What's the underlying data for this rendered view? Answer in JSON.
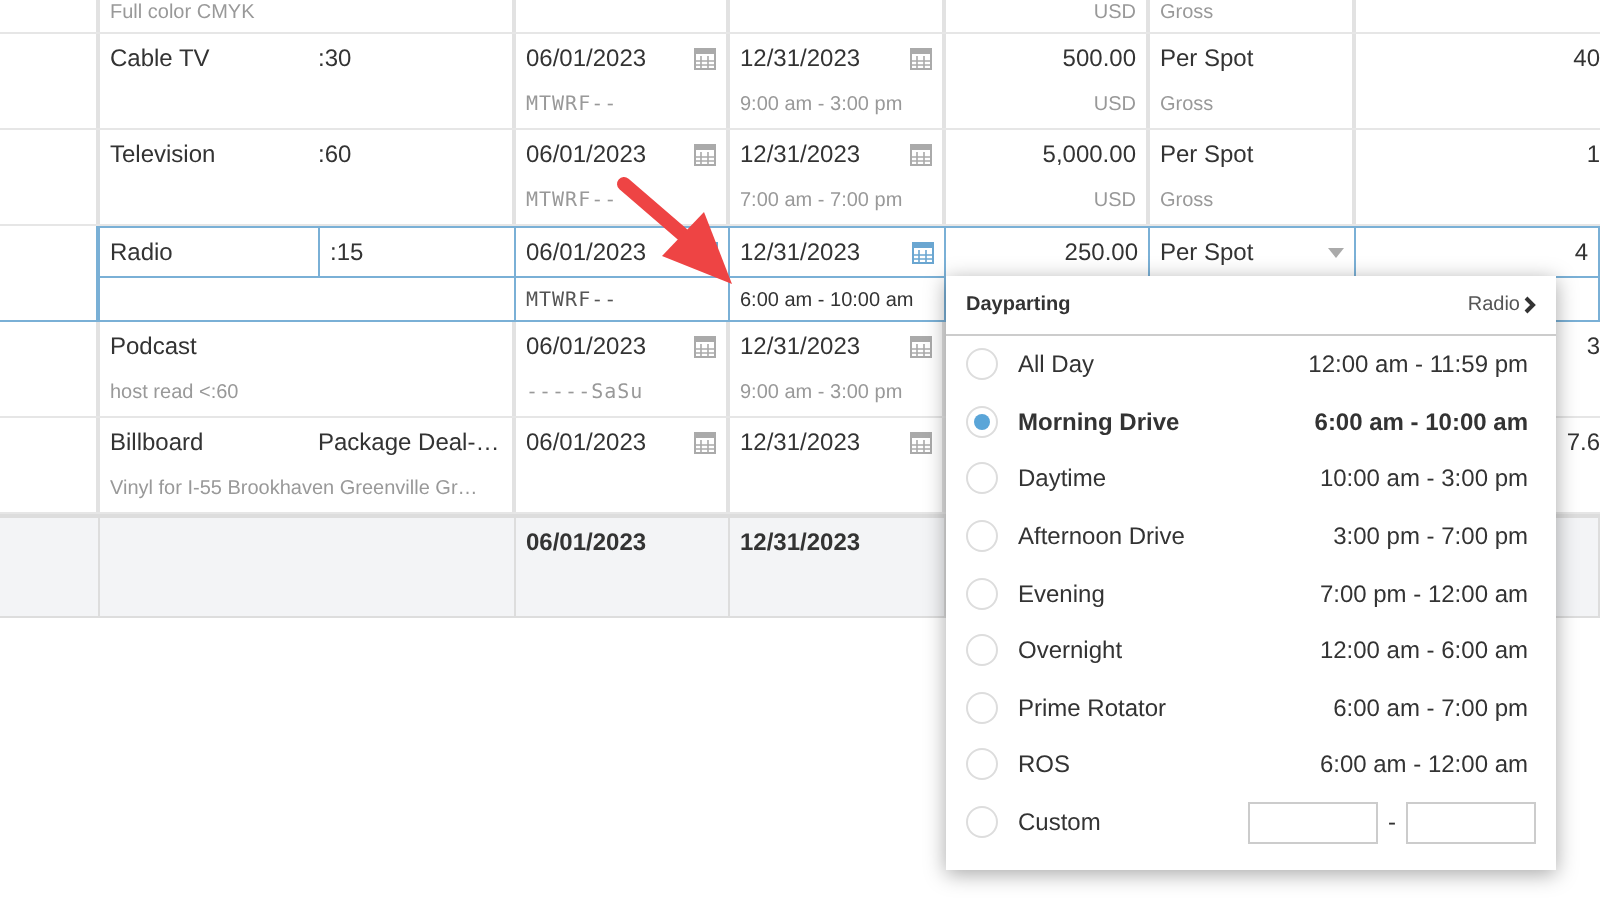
{
  "rows": [
    {
      "kind": "partial",
      "note": "Full color CMYK",
      "currency": "USD",
      "basis": "Gross"
    },
    {
      "kind": "line",
      "selected": false,
      "name": "Cable TV",
      "duration": ":30",
      "start": "06/01/2023",
      "end": "12/31/2023",
      "days": "MTWRF--",
      "time": "9:00 am - 3:00 pm",
      "amount": "500.00",
      "unit": "Per Spot",
      "currency": "USD",
      "basis": "Gross",
      "quantity": "40"
    },
    {
      "kind": "line",
      "selected": false,
      "name": "Television",
      "duration": ":60",
      "start": "06/01/2023",
      "end": "12/31/2023",
      "days": "MTWRF--",
      "time": "7:00 am - 7:00 pm",
      "amount": "5,000.00",
      "unit": "Per Spot",
      "currency": "USD",
      "basis": "Gross",
      "quantity": "1"
    },
    {
      "kind": "line",
      "selected": true,
      "name": "Radio",
      "duration": ":15",
      "start": "06/01/2023",
      "end": "12/31/2023",
      "days": "MTWRF--",
      "time": "6:00 am - 10:00 am",
      "amount": "250.00",
      "unit": "Per Spot",
      "quantity": "4"
    },
    {
      "kind": "line",
      "selected": false,
      "name": "Podcast",
      "note": "host read <:60",
      "start": "06/01/2023",
      "end": "12/31/2023",
      "days": "-----SaSu",
      "time": "9:00 am - 3:00 pm",
      "quantity": "3"
    },
    {
      "kind": "line",
      "selected": false,
      "name": "Billboard",
      "duration": "Package Deal-…",
      "note": "Vinyl for I-55 Brookhaven Greenville Gr…",
      "start": "06/01/2023",
      "end": "12/31/2023",
      "quantity": "7.6"
    }
  ],
  "total": {
    "start": "06/01/2023",
    "end": "12/31/2023"
  },
  "dayparting": {
    "title": "Dayparting",
    "link": "Radio",
    "options": [
      {
        "kind": "preset",
        "label": "All Day",
        "time": "12:00 am - 11:59 pm",
        "selected": false
      },
      {
        "kind": "preset",
        "label": "Morning Drive",
        "time": "6:00 am - 10:00 am",
        "selected": true
      },
      {
        "kind": "preset",
        "label": "Daytime",
        "time": "10:00 am - 3:00 pm",
        "selected": false
      },
      {
        "kind": "preset",
        "label": "Afternoon Drive",
        "time": "3:00 pm - 7:00 pm",
        "selected": false
      },
      {
        "kind": "preset",
        "label": "Evening",
        "time": "7:00 pm - 12:00 am",
        "selected": false
      },
      {
        "kind": "preset",
        "label": "Overnight",
        "time": "12:00 am - 6:00 am",
        "selected": false
      },
      {
        "kind": "preset",
        "label": "Prime Rotator",
        "time": "6:00 am - 7:00 pm",
        "selected": false
      },
      {
        "kind": "preset",
        "label": "ROS",
        "time": "6:00 am - 12:00 am",
        "selected": false
      },
      {
        "kind": "custom",
        "label": "Custom",
        "separator": "-",
        "selected": false
      }
    ]
  }
}
